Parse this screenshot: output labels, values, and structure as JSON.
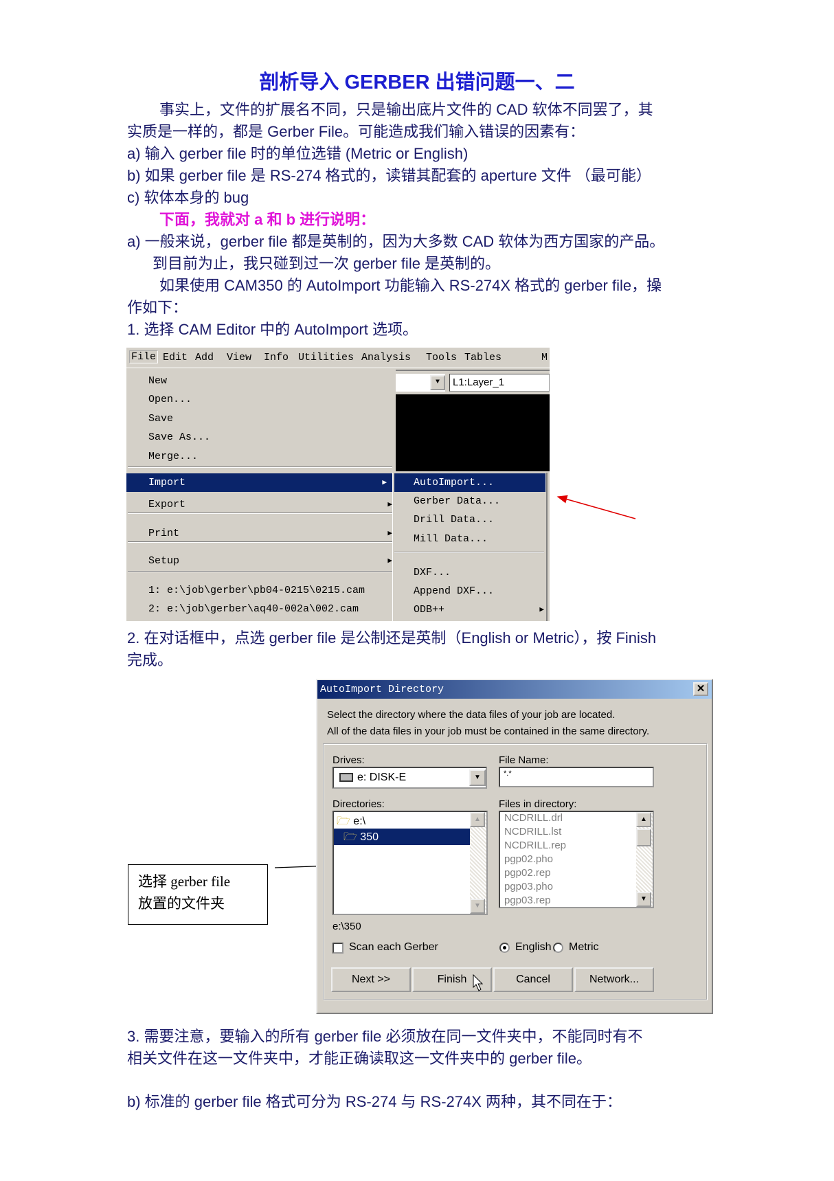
{
  "title": "剖析导入 GERBER 出错问题一、二",
  "intro": {
    "line1": "事实上，文件的扩展名不同，只是输出底片文件的 CAD 软体不同罢了，其",
    "line2": "实质是一样的，都是 Gerber File。可能造成我们输入错误的因素有：",
    "a": "a)  输入 gerber file 时的单位选错  (Metric or English)",
    "b": "b)  如果 gerber file 是 RS-274 格式的，读错其配套的 aperture 文件  （最可能）",
    "c": "c)  软体本身的 bug",
    "highlight": "下面，我就对 a 和 b 进行说明："
  },
  "section_a": {
    "line1": "a)  一般来说，gerber file 都是英制的，因为大多数 CAD 软体为西方国家的产品。",
    "line2": "到目前为止，我只碰到过一次 gerber file 是英制的。",
    "line3": "如果使用 CAM350 的 AutoImport 功能输入 RS-274X 格式的 gerber file，操",
    "line4": "作如下：",
    "step1": "1. 选择 CAM Editor 中的 AutoImport 选项。"
  },
  "menu": {
    "bar": [
      "File",
      "Edit",
      "Add",
      "View",
      "Info",
      "Utilities",
      "Analysis",
      "Tools",
      "Tables",
      "M"
    ],
    "items": [
      "New",
      "Open...",
      "Save",
      "Save As...",
      "Merge...",
      "Import",
      "Export",
      "Print",
      "Setup",
      "1:  e:\\job\\gerber\\pb04-0215\\0215.cam",
      "2:  e:\\job\\gerber\\aq40-002a\\002.cam"
    ],
    "submenu": [
      "AutoImport...",
      "Gerber Data...",
      "Drill Data...",
      "Mill Data...",
      "DXF...",
      "Append DXF...",
      "ODB++"
    ],
    "layer": "L1:Layer_1"
  },
  "step2": {
    "line1": "2. 在对话框中，点选 gerber file 是公制还是英制（English or Metric），按 Finish",
    "line2": "完成。"
  },
  "dialog": {
    "title": "AutoImport Directory",
    "desc1": "Select the directory where the data files of your job are located.",
    "desc2": "All of the data files in your job must be contained in the same directory.",
    "drives_label": "Drives:",
    "drive": "e: DISK-E",
    "filename_label": "File Name:",
    "filename": "*.*",
    "dirs_label": "Directories:",
    "dirs": [
      "e:\\",
      "350"
    ],
    "files_label": "Files in directory:",
    "files": [
      "NCDRILL.drl",
      "NCDRILL.lst",
      "NCDRILL.rep",
      "pgp02.pho",
      "pgp02.rep",
      "pgp03.pho",
      "pgp03.rep"
    ],
    "path": "e:\\350",
    "scan": "Scan each Gerber",
    "english": "English",
    "metric": "Metric",
    "units_selected": "English",
    "buttons": [
      "Next >>",
      "Finish",
      "Cancel",
      "Network..."
    ]
  },
  "callout": {
    "line1": "选择  gerber  file",
    "line2": "放置的文件夹"
  },
  "step3": {
    "line1": "3. 需要注意，要输入的所有 gerber  file 必须放在同一文件夹中，不能同时有不",
    "line2": "相关文件在这一文件夹中，才能正确读取这一文件夹中的 gerber file。"
  },
  "section_b": "b)  标准的 gerber file 格式可分为 RS-274 与 RS-274X 两种，其不同在于：",
  "colors": {
    "title": "#1d1fd0",
    "text": "#1c1c6a",
    "highlight": "#e014d8",
    "arrow": "#e00000",
    "selection": "#0a246a"
  }
}
